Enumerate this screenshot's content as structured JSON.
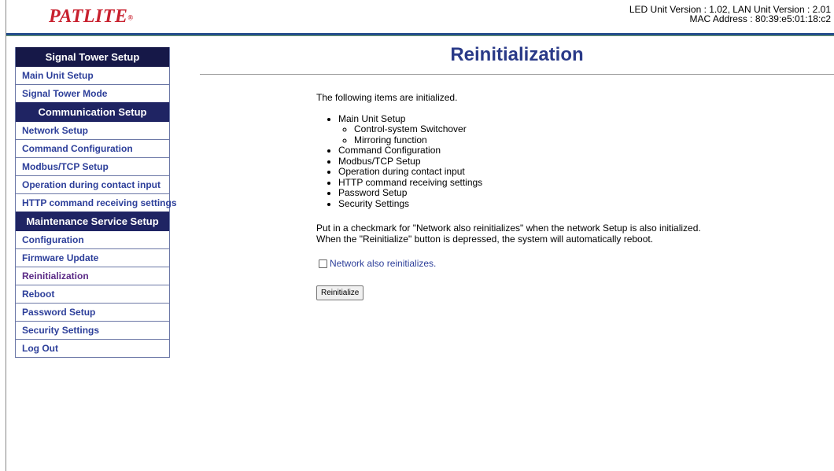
{
  "header": {
    "logo": "PATLITE",
    "logo_mark": "®",
    "version_line": "LED Unit Version : 1.02, LAN Unit Version : 2.01",
    "mac_line": "MAC Address : 80:39:e5:01:18:c2"
  },
  "colors": {
    "accent": "#2a3a88",
    "logo": "#c8202e",
    "sidebar_head": "#1f2463"
  },
  "sidebar": {
    "sections": [
      {
        "title": "Signal Tower Setup",
        "items": [
          {
            "label": "Main Unit Setup"
          },
          {
            "label": "Signal Tower Mode"
          }
        ]
      },
      {
        "title": "Communication Setup",
        "items": [
          {
            "label": "Network Setup"
          },
          {
            "label": "Command Configuration"
          },
          {
            "label": "Modbus/TCP Setup"
          },
          {
            "label": "Operation during contact input"
          },
          {
            "label": "HTTP command receiving settings"
          }
        ]
      },
      {
        "title": "Maintenance Service Setup",
        "items": [
          {
            "label": "Configuration"
          },
          {
            "label": "Firmware Update"
          },
          {
            "label": "Reinitialization"
          },
          {
            "label": "Reboot"
          },
          {
            "label": "Password Setup"
          },
          {
            "label": "Security Settings"
          },
          {
            "label": "Log Out"
          }
        ]
      }
    ]
  },
  "main": {
    "title": "Reinitialization",
    "intro": "The following items are initialized.",
    "items": [
      {
        "label": "Main Unit Setup",
        "sub": [
          "Control-system Switchover",
          "Mirroring function"
        ]
      },
      {
        "label": "Command Configuration"
      },
      {
        "label": "Modbus/TCP Setup"
      },
      {
        "label": "Operation during contact input"
      },
      {
        "label": "HTTP command receiving settings"
      },
      {
        "label": "Password Setup"
      },
      {
        "label": "Security Settings"
      }
    ],
    "note_1": "Put in a checkmark for \"Network also reinitializes\" when the network Setup is also initialized.",
    "note_2": "When the \"Reinitialize\" button is depressed, the system will automatically reboot.",
    "checkbox_label": "Network also reinitializes.",
    "checkbox_checked": false,
    "button_label": "Reinitialize"
  }
}
